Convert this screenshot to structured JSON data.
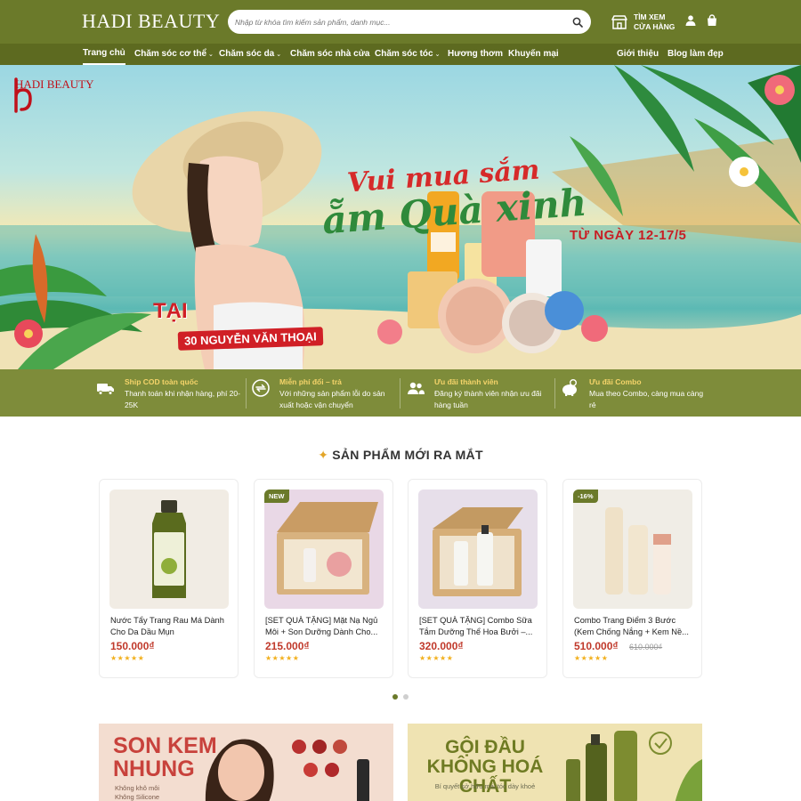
{
  "header": {
    "logo": "HADI BEAUTY",
    "search_placeholder": "Nhập từ khóa tìm kiếm sản phẩm, danh mục...",
    "store_line1": "TÌM XEM",
    "store_line2": "CỬA HÀNG"
  },
  "nav": {
    "items": [
      {
        "label": "Trang chủ",
        "dropdown": false
      },
      {
        "label": "Chăm sóc cơ thể",
        "dropdown": true
      },
      {
        "label": "Chăm sóc da",
        "dropdown": true
      },
      {
        "label": "Chăm sóc nhà cửa",
        "dropdown": false
      },
      {
        "label": "Chăm sóc tóc",
        "dropdown": true
      },
      {
        "label": "Hương thơm",
        "dropdown": false
      },
      {
        "label": "Khuyến mại",
        "dropdown": false
      }
    ],
    "right_items": [
      {
        "label": "Giới thiệu"
      },
      {
        "label": "Blog làm đẹp"
      }
    ],
    "chevron": "⌄"
  },
  "banner": {
    "brand": "HADI BEAUTY",
    "line1": "Vui mua sắm",
    "line2": "ẵm Quà xinh",
    "date": "TỪ NGÀY 12-17/5",
    "at": "TẠI",
    "address": "30 NGUYỄN VĂN THOẠI"
  },
  "features": [
    {
      "icon": "truck-icon",
      "title": "Ship COD toàn quốc",
      "desc": "Thanh toán khi nhận hàng, phí 20-25K"
    },
    {
      "icon": "exchange-icon",
      "title": "Miễn phí đổi – trả",
      "desc": "Với những sản phẩm lỗi do sản xuất hoặc vận chuyển"
    },
    {
      "icon": "members-icon",
      "title": "Ưu đãi thành viên",
      "desc": "Đăng ký thành viên nhận ưu đãi hàng tuần"
    },
    {
      "icon": "piggy-bank-icon",
      "title": "Ưu đãi Combo",
      "desc": "Mua theo Combo, càng mua càng rẻ"
    }
  ],
  "section": {
    "title": "SẢN PHẨM MỚI RA MẮT",
    "spark": "✦"
  },
  "products": [
    {
      "name": "Nước Tẩy Trang Rau Má Dành Cho Da Dầu Mụn",
      "price": "150.000₫",
      "old_price": "",
      "badge": "",
      "rating": 5,
      "stars": "★★★★★"
    },
    {
      "name": "[SET QUÀ TẶNG] Mặt Nạ Ngủ Môi + Son Dưỡng Dành Cho...",
      "price": "215.000₫",
      "old_price": "",
      "badge": "NEW",
      "rating": 5,
      "stars": "★★★★★"
    },
    {
      "name": "[SET QUÀ TẶNG] Combo Sữa Tắm Dưỡng Thể Hoa Bưởi –...",
      "price": "320.000₫",
      "old_price": "",
      "badge": "",
      "rating": 5,
      "stars": "★★★★★"
    },
    {
      "name": "Combo Trang Điểm 3 Bước (Kem Chống Nắng + Kem Nề...",
      "price": "510.000₫",
      "old_price": "610.000₫",
      "badge": "-16%",
      "rating": 5,
      "stars": "★★★★★"
    }
  ],
  "carousel": {
    "pages": 2,
    "active": 1
  },
  "tiles": [
    {
      "title_line1": "SON KEM",
      "title_line2": "NHUNG",
      "sub_line1": "Không khô môi",
      "sub_line2": "Không Silicone"
    },
    {
      "title_line1": "GỘI ĐẦU",
      "title_line2": "KHÔNG HOÁ CHẤT",
      "sub": "Bí quyết sở hữu mái tóc dày khoẻ"
    }
  ],
  "colors": {
    "brand_green": "#6b7a2a",
    "nav_green": "#5d6a20",
    "feature_bar": "#7e8c3a",
    "price_red": "#c0392b",
    "star_yellow": "#f2b01e",
    "accent_yellow": "#f5d46a"
  }
}
